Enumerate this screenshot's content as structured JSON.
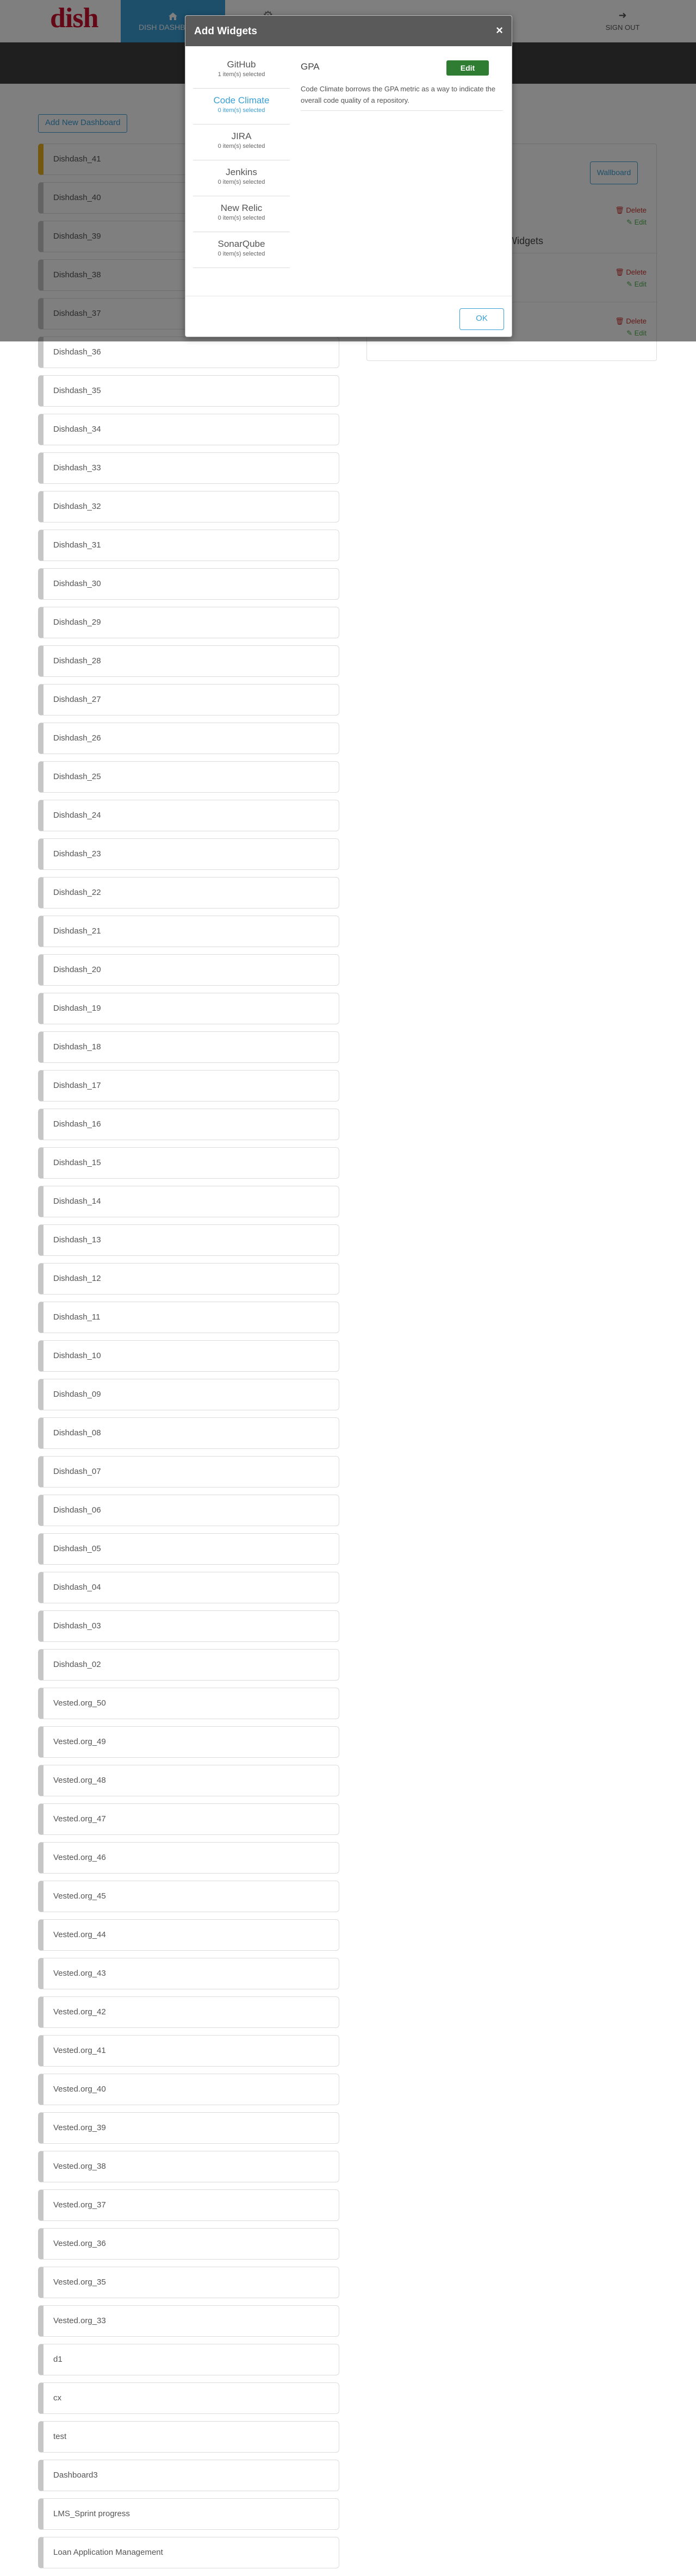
{
  "header": {
    "logo": "dish",
    "nav_active_label": "DISH DASHBOARD",
    "sign_out_label": "SIGN OUT"
  },
  "add_dashboard_label": "Add New Dashboard",
  "dashboards": [
    "Dishdash_41",
    "Dishdash_40",
    "Dishdash_39",
    "Dishdash_38",
    "Dishdash_37",
    "Dishdash_36",
    "Dishdash_35",
    "Dishdash_34",
    "Dishdash_33",
    "Dishdash_32",
    "Dishdash_31",
    "Dishdash_30",
    "Dishdash_29",
    "Dishdash_28",
    "Dishdash_27",
    "Dishdash_26",
    "Dishdash_25",
    "Dishdash_24",
    "Dishdash_23",
    "Dishdash_22",
    "Dishdash_21",
    "Dishdash_20",
    "Dishdash_19",
    "Dishdash_18",
    "Dishdash_17",
    "Dishdash_16",
    "Dishdash_15",
    "Dishdash_14",
    "Dishdash_13",
    "Dishdash_12",
    "Dishdash_11",
    "Dishdash_10",
    "Dishdash_09",
    "Dishdash_08",
    "Dishdash_07",
    "Dishdash_06",
    "Dishdash_05",
    "Dishdash_04",
    "Dishdash_03",
    "Dishdash_02",
    "Vested.org_50",
    "Vested.org_49",
    "Vested.org_48",
    "Vested.org_47",
    "Vested.org_46",
    "Vested.org_45",
    "Vested.org_44",
    "Vested.org_43",
    "Vested.org_42",
    "Vested.org_41",
    "Vested.org_40",
    "Vested.org_39",
    "Vested.org_38",
    "Vested.org_37",
    "Vested.org_36",
    "Vested.org_35",
    "Vested.org_33",
    "d1",
    "cx",
    "test",
    "Dashboard3",
    "LMS_Sprint progress",
    "Loan Application Management"
  ],
  "right_panel": {
    "wallboard_label": "Wallboard",
    "title_partial": "d Widgets",
    "delete_label": "Delete",
    "edit_label": "Edit"
  },
  "modal": {
    "title": "Add Widgets",
    "close": "×",
    "sources": [
      {
        "name": "GitHub",
        "count": "1 item(s) selected"
      },
      {
        "name": "Code Climate",
        "count": "0 item(s) selected"
      },
      {
        "name": "JIRA",
        "count": "0 item(s) selected"
      },
      {
        "name": "Jenkins",
        "count": "0 item(s) selected"
      },
      {
        "name": "New Relic",
        "count": "0 item(s) selected"
      },
      {
        "name": "SonarQube",
        "count": "0 item(s) selected"
      }
    ],
    "active_source_index": 1,
    "widget": {
      "name": "GPA",
      "edit_label": "Edit",
      "description": "Code Climate borrows the GPA metric as a way to indicate the overall code quality of a repository."
    },
    "ok_label": "OK"
  },
  "colors": {
    "accent": "#3a9fd6",
    "brand": "#c8102e",
    "edit_green": "#2e7d32",
    "active_dashboard": "#e8b021"
  }
}
